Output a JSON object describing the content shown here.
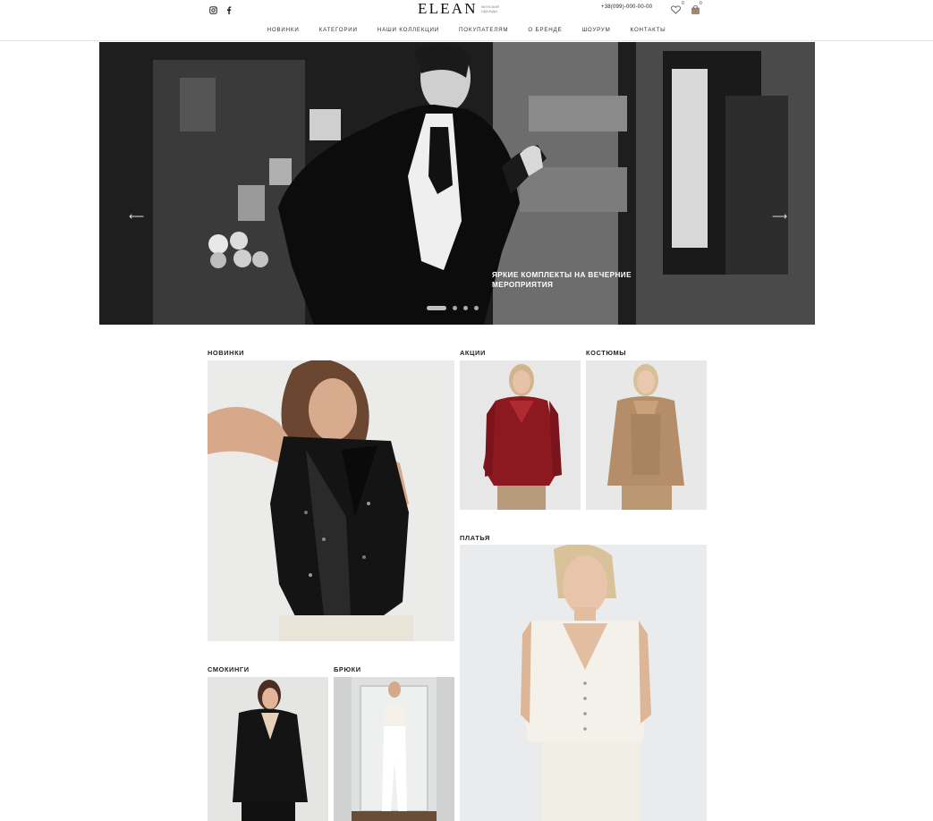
{
  "header": {
    "social": [
      {
        "icon": "instagram-icon"
      },
      {
        "icon": "facebook-icon"
      }
    ],
    "logo": {
      "word": "ELEAN",
      "tagline": "женский одежды"
    },
    "phone": "+38(099)-000-00-00",
    "wishlist": {
      "icon": "heart-icon",
      "count": "0"
    },
    "cart": {
      "icon": "bag-icon",
      "count": "0"
    }
  },
  "nav": {
    "items": [
      "НОВИНКИ",
      "КАТЕГОРИИ",
      "НАШИ КОЛЛЕКЦИИ",
      "ПОКУПАТЕЛЯМ",
      "О БРЕНДЕ",
      "ШОУРУМ",
      "КОНТАКТЫ"
    ]
  },
  "hero": {
    "caption": "ЯРКИЕ КОМПЛЕКТЫ НА ВЕЧЕРНИЕ МЕРОПРИЯТИЯ",
    "prev_icon": "arrow-left-icon",
    "next_icon": "arrow-right-icon",
    "slides": 4,
    "active_slide": 1
  },
  "categories": {
    "new": "НОВИНКИ",
    "sale": "АКЦИИ",
    "suits": "КОСТЮМЫ",
    "dresses": "ПЛАТЬЯ",
    "tuxedos": "СМОКИНГИ",
    "trousers": "БРЮКИ"
  },
  "colors": {
    "background": "#ffffff",
    "text": "#222222",
    "hero_overlay": "#2a2a2a"
  }
}
